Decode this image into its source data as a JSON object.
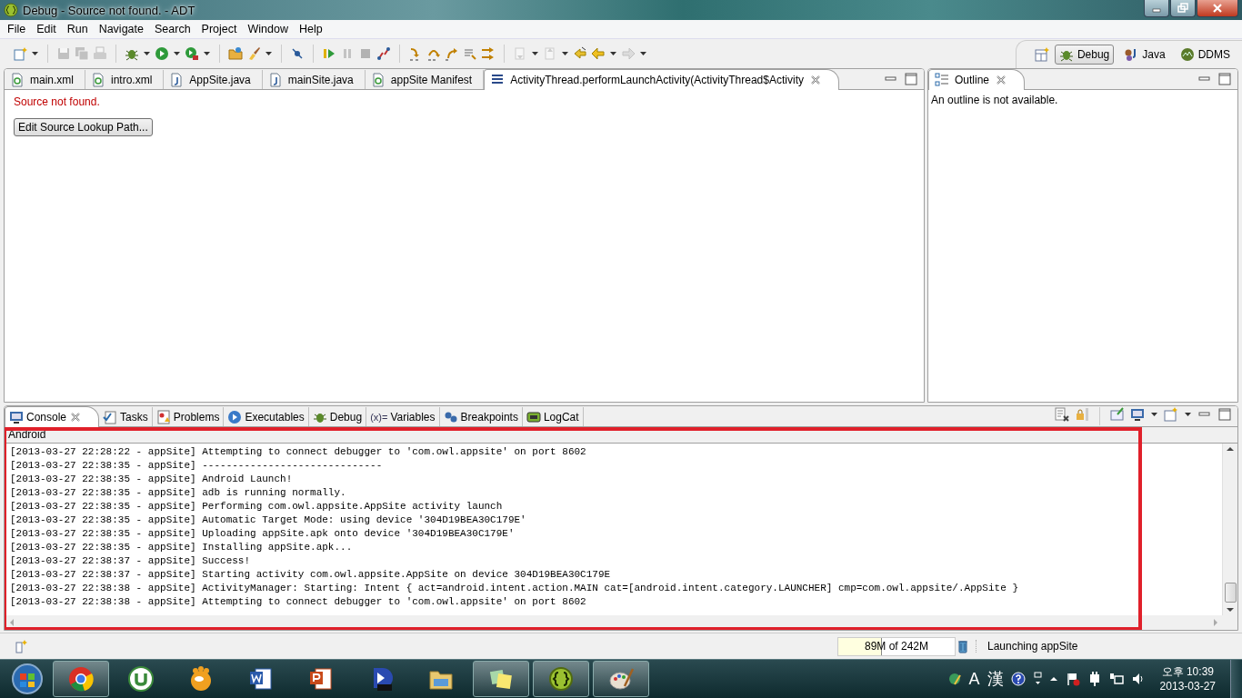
{
  "window": {
    "title": "Debug - Source not found. - ADT"
  },
  "menu": [
    "File",
    "Edit",
    "Run",
    "Navigate",
    "Search",
    "Project",
    "Window",
    "Help"
  ],
  "toolbar": [
    {
      "kind": "new",
      "disabled": false
    },
    {
      "kind": "caret"
    },
    {
      "kind": "separator"
    },
    {
      "kind": "save",
      "disabled": true
    },
    {
      "kind": "saveall",
      "disabled": true
    },
    {
      "kind": "print",
      "disabled": true
    },
    {
      "kind": "separator"
    },
    {
      "kind": "debug",
      "disabled": false
    },
    {
      "kind": "caret"
    },
    {
      "kind": "run",
      "disabled": false
    },
    {
      "kind": "caret"
    },
    {
      "kind": "tools",
      "disabled": false
    },
    {
      "kind": "caret"
    },
    {
      "kind": "separator"
    },
    {
      "kind": "folder",
      "disabled": false
    },
    {
      "kind": "brush",
      "disabled": false
    },
    {
      "kind": "caret"
    },
    {
      "kind": "separator"
    },
    {
      "kind": "skip",
      "disabled": false
    },
    {
      "kind": "separator"
    },
    {
      "kind": "resume",
      "disabled": false
    },
    {
      "kind": "suspend",
      "disabled": true
    },
    {
      "kind": "terminate",
      "disabled": true
    },
    {
      "kind": "disconnect",
      "disabled": false
    },
    {
      "kind": "separator"
    },
    {
      "kind": "stepinto",
      "disabled": false
    },
    {
      "kind": "stepover",
      "disabled": false
    },
    {
      "kind": "stepreturn",
      "disabled": false
    },
    {
      "kind": "dropframe",
      "disabled": false
    },
    {
      "kind": "filters",
      "disabled": false
    },
    {
      "kind": "separator"
    },
    {
      "kind": "next",
      "disabled": true
    },
    {
      "kind": "caret"
    },
    {
      "kind": "prev",
      "disabled": true
    },
    {
      "kind": "caret"
    },
    {
      "kind": "lastedit",
      "disabled": false
    },
    {
      "kind": "back",
      "disabled": false
    },
    {
      "kind": "caret"
    },
    {
      "kind": "forward",
      "disabled": true
    },
    {
      "kind": "caret"
    }
  ],
  "perspectives": [
    {
      "label": "Debug",
      "kind": "debug",
      "selected": true
    },
    {
      "label": "Java",
      "kind": "java",
      "selected": false
    },
    {
      "label": "DDMS",
      "kind": "ddms",
      "selected": false
    }
  ],
  "editor": {
    "tabs": [
      {
        "label": "main.xml",
        "kind": "xml",
        "selected": false
      },
      {
        "label": "intro.xml",
        "kind": "xml",
        "selected": false
      },
      {
        "label": "AppSite.java",
        "kind": "java",
        "selected": false
      },
      {
        "label": "mainSite.java",
        "kind": "java",
        "selected": false
      },
      {
        "label": "appSite Manifest",
        "kind": "xml",
        "selected": false
      },
      {
        "label": "ActivityThread.performLaunchActivity(ActivityThread$Activity",
        "kind": "class",
        "selected": true
      }
    ],
    "message": "Source not found.",
    "button": "Edit Source Lookup Path..."
  },
  "outline": {
    "tab": "Outline",
    "message": "An outline is not available."
  },
  "console": {
    "tabs": [
      {
        "label": "Console",
        "kind": "console",
        "selected": true
      },
      {
        "label": "Tasks",
        "kind": "tasks",
        "selected": false
      },
      {
        "label": "Problems",
        "kind": "problems",
        "selected": false
      },
      {
        "label": "Executables",
        "kind": "executables",
        "selected": false
      },
      {
        "label": "Debug",
        "kind": "debug",
        "selected": false
      },
      {
        "label": "Variables",
        "kind": "variables",
        "icon_text": "(x)=",
        "selected": false
      },
      {
        "label": "Breakpoints",
        "kind": "breakpoints",
        "selected": false
      },
      {
        "label": "LogCat",
        "kind": "logcat",
        "selected": false
      }
    ],
    "name": "Android",
    "lines": [
      "[2013-03-27 22:28:22 - appSite] Attempting to connect debugger to 'com.owl.appsite' on port 8602",
      "[2013-03-27 22:38:35 - appSite] ------------------------------",
      "[2013-03-27 22:38:35 - appSite] Android Launch!",
      "[2013-03-27 22:38:35 - appSite] adb is running normally.",
      "[2013-03-27 22:38:35 - appSite] Performing com.owl.appsite.AppSite activity launch",
      "[2013-03-27 22:38:35 - appSite] Automatic Target Mode: using device '304D19BEA30C179E'",
      "[2013-03-27 22:38:35 - appSite] Uploading appSite.apk onto device '304D19BEA30C179E'",
      "[2013-03-27 22:38:35 - appSite] Installing appSite.apk...",
      "[2013-03-27 22:38:37 - appSite] Success!",
      "[2013-03-27 22:38:37 - appSite] Starting activity com.owl.appsite.AppSite on device 304D19BEA30C179E",
      "[2013-03-27 22:38:38 - appSite] ActivityManager: Starting: Intent { act=android.intent.action.MAIN cat=[android.intent.category.LAUNCHER] cmp=com.owl.appsite/.AppSite }",
      "[2013-03-27 22:38:38 - appSite] Attempting to connect debugger to 'com.owl.appsite' on port 8602"
    ]
  },
  "status_bar": {
    "heap": {
      "text": "89M of 242M",
      "level": 0.37
    },
    "message": "Launching appSite"
  },
  "taskbar": {
    "apps": [
      {
        "kind": "chrome",
        "open": true
      },
      {
        "kind": "torrent",
        "open": false
      },
      {
        "kind": "player",
        "open": false
      },
      {
        "kind": "word",
        "open": false
      },
      {
        "kind": "powerpoint",
        "open": false
      },
      {
        "kind": "movie",
        "open": false
      },
      {
        "kind": "explorer",
        "open": false
      },
      {
        "kind": "notes",
        "open": true
      },
      {
        "kind": "adt",
        "open": true
      },
      {
        "kind": "paint",
        "open": true
      }
    ],
    "language": [
      "A",
      "漢"
    ],
    "clock_time": "오후 10:39",
    "clock_date": "2013-03-27"
  }
}
